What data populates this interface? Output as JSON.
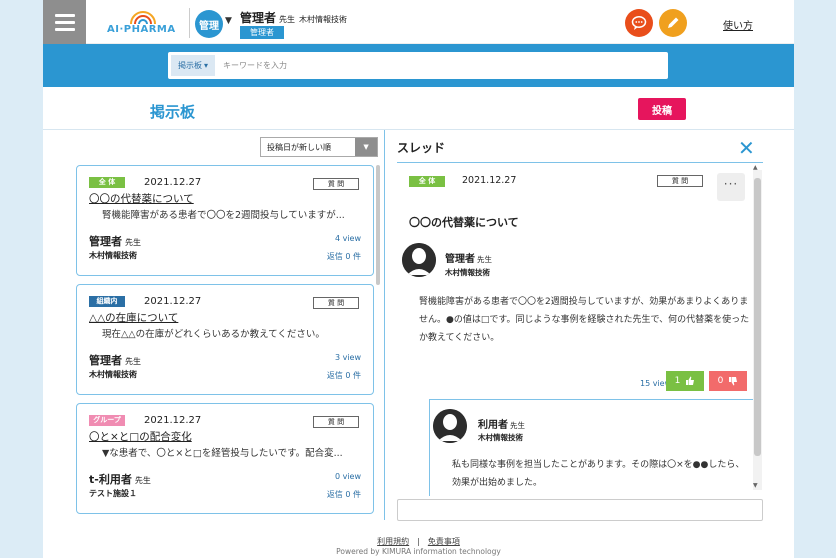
{
  "header": {
    "logo_text": "AI·PHARMA",
    "role_circle": "管理",
    "user_name": "管理者",
    "user_title": "先生",
    "user_org": "木村情報技術",
    "user_role_badge": "管理者",
    "help_link": "使い方",
    "chat_icon": "chat-bubble-icon",
    "edit_icon": "pencil-icon"
  },
  "search": {
    "category": "掲示板",
    "placeholder": "キーワードを入力"
  },
  "page": {
    "title": "掲示板",
    "post_button": "投稿"
  },
  "list": {
    "sort_label": "投稿日が新しい順",
    "items": [
      {
        "badge": "全 体",
        "badge_type": "all",
        "date": "2021.12.27",
        "type_label": "質 問",
        "title": "〇〇の代替薬について",
        "excerpt": "腎機能障害がある患者で〇〇を2週間投与していますが...",
        "author": "管理者",
        "author_title": "先生",
        "org": "木村情報技術",
        "views": "4 view",
        "replies": "返信 0 件"
      },
      {
        "badge": "組織内",
        "badge_type": "org",
        "date": "2021.12.27",
        "type_label": "質 問",
        "title": "△△の在庫について",
        "excerpt": "現在△△の在庫がどれくらいあるか教えてください。",
        "author": "管理者",
        "author_title": "先生",
        "org": "木村情報技術",
        "views": "3 view",
        "replies": "返信 0 件"
      },
      {
        "badge": "グループ",
        "badge_type": "group",
        "date": "2021.12.27",
        "type_label": "質 問",
        "title": "〇と×と□の配合変化",
        "excerpt": "▼な患者で、〇と×と□を経管投与したいです。配合変...",
        "author": "t-利用者",
        "author_title": "先生",
        "org": "テスト施設１",
        "views": "0 view",
        "replies": "返信 0 件"
      }
    ]
  },
  "thread": {
    "title": "スレッド",
    "badge": "全 体",
    "date": "2021.12.27",
    "type_label": "質 問",
    "more": "···",
    "subject": "〇〇の代替薬について",
    "author": "管理者",
    "author_title": "先生",
    "org": "木村情報技術",
    "body": "腎機能障害がある患者で〇〇を2週間投与していますが、効果があまりよくありません。●の値は□です。同じような事例を経験された先生で、何の代替薬を使ったか教えてください。",
    "views": "15 view",
    "likes": "1",
    "dislikes": "0",
    "reply": {
      "author": "利用者",
      "author_title": "先生",
      "org": "木村情報技術",
      "body": "私も同様な事例を担当したことがあります。その際は〇×を●●したら、効果が出始めました。"
    }
  },
  "footer": {
    "terms": "利用規約",
    "disclaimer": "免責事項",
    "copyright": "Powered by KIMURA information technology"
  },
  "colors": {
    "brand_blue": "#2b96d1",
    "post_pink": "#e6155d",
    "chat_orange": "#e94e1b",
    "edit_orange": "#f0a01e",
    "badge_green": "#7ac043",
    "badge_navy": "#2b6fa5",
    "badge_pink": "#f08cb2"
  }
}
